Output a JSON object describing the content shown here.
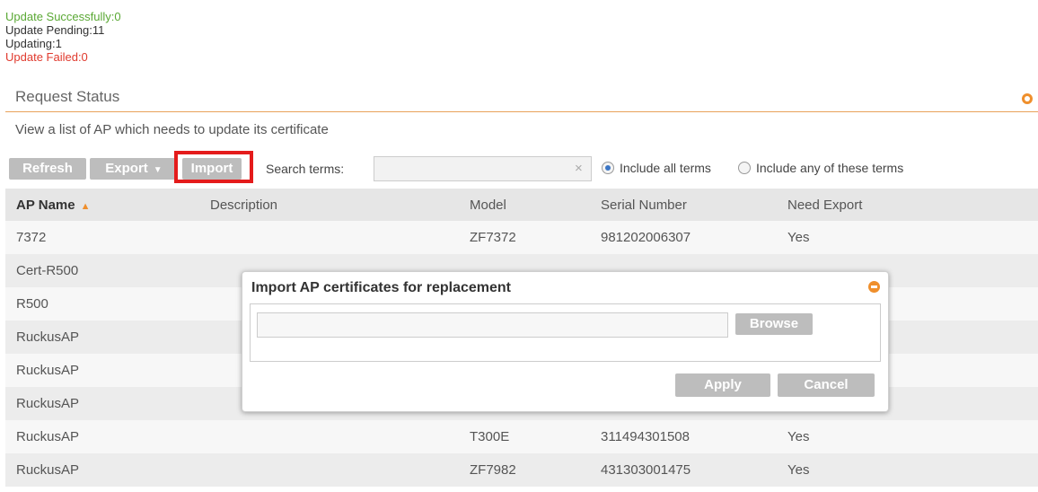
{
  "status": {
    "success": "Update Successfully:0",
    "pending": "Update Pending:11",
    "updating": "Updating:1",
    "failed": "Update Failed:0"
  },
  "section": {
    "title": "Request Status",
    "description": "View a list of AP which needs to update its certificate"
  },
  "toolbar": {
    "refresh_label": "Refresh",
    "export_label": "Export",
    "import_label": "Import",
    "search_label": "Search terms:",
    "search_value": "",
    "clear_glyph": "×",
    "include_all_label": "Include all terms",
    "include_any_label": "Include any of these terms",
    "include_all_selected": true
  },
  "table": {
    "columns": [
      "AP Name",
      "Description",
      "Model",
      "Serial Number",
      "Need Export"
    ],
    "sort_column": "AP Name",
    "rows": [
      [
        "7372",
        "",
        "ZF7372",
        "981202006307",
        "Yes"
      ],
      [
        "Cert-R500",
        "",
        "",
        "",
        ""
      ],
      [
        "R500",
        "",
        "",
        "",
        ""
      ],
      [
        "RuckusAP",
        "",
        "",
        "",
        ""
      ],
      [
        "RuckusAP",
        "",
        "",
        "",
        ""
      ],
      [
        "RuckusAP",
        "",
        "",
        "",
        ""
      ],
      [
        "RuckusAP",
        "",
        "T300E",
        "311494301508",
        "Yes"
      ],
      [
        "RuckusAP",
        "",
        "ZF7982",
        "431303001475",
        "Yes"
      ]
    ]
  },
  "dialog": {
    "title": "Import AP certificates for replacement",
    "file_value": "",
    "browse_label": "Browse",
    "apply_label": "Apply",
    "cancel_label": "Cancel"
  },
  "colors": {
    "accent": "#ef8f2c",
    "success": "#5aa834",
    "failed": "#e03a2e",
    "highlight": "#e41b1b"
  }
}
